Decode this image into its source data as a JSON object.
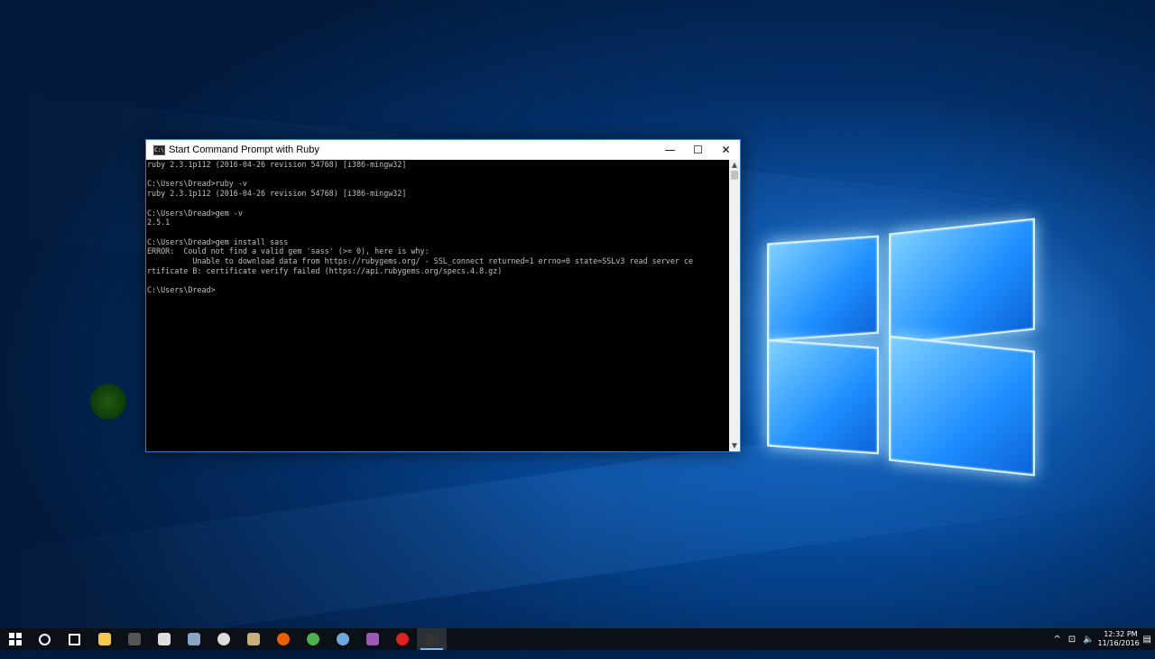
{
  "window": {
    "title": "Start Command Prompt with Ruby",
    "icon_label": "C:\\",
    "controls": {
      "minimize": "—",
      "maximize": "☐",
      "close": "✕"
    }
  },
  "console": {
    "lines": [
      "ruby 2.3.1p112 (2016-04-26 revision 54768) [i386-mingw32]",
      "",
      "C:\\Users\\Dread>ruby -v",
      "ruby 2.3.1p112 (2016-04-26 revision 54768) [i386-mingw32]",
      "",
      "C:\\Users\\Dread>gem -v",
      "2.5.1",
      "",
      "C:\\Users\\Dread>gem install sass",
      "ERROR:  Could not find a valid gem 'sass' (>= 0), here is why:",
      "          Unable to download data from https://rubygems.org/ - SSL_connect returned=1 errno=0 state=SSLv3 read server ce",
      "rtificate B: certificate verify failed (https://api.rubygems.org/specs.4.8.gz)",
      "",
      "C:\\Users\\Dread>"
    ]
  },
  "taskbar": {
    "icons": [
      {
        "name": "start-icon",
        "color": "#ffffff"
      },
      {
        "name": "search-icon",
        "color": "#ffffff"
      },
      {
        "name": "task-view-icon",
        "color": "#ffffff"
      },
      {
        "name": "file-explorer-icon",
        "color": "#f2c94c"
      },
      {
        "name": "command-prompt-icon",
        "color": "#555555"
      },
      {
        "name": "calculator-icon",
        "color": "#dddddd"
      },
      {
        "name": "app-icon",
        "color": "#8aa4c8"
      },
      {
        "name": "github-icon",
        "color": "#dddddd"
      },
      {
        "name": "image-app-icon",
        "color": "#c8b27a"
      },
      {
        "name": "firefox-icon",
        "color": "#e66000"
      },
      {
        "name": "chrome-icon",
        "color": "#4caf50"
      },
      {
        "name": "web-app-icon",
        "color": "#6fa8dc"
      },
      {
        "name": "visual-studio-icon",
        "color": "#9b59b6"
      },
      {
        "name": "record-icon",
        "color": "#e02020"
      },
      {
        "name": "cmd-window-icon",
        "color": "#333333"
      }
    ],
    "tray": {
      "chevron": "^",
      "network": "⊡",
      "volume": "🔈",
      "notifications": "▤",
      "time": "12:32 PM",
      "date": "11/16/2016"
    }
  }
}
